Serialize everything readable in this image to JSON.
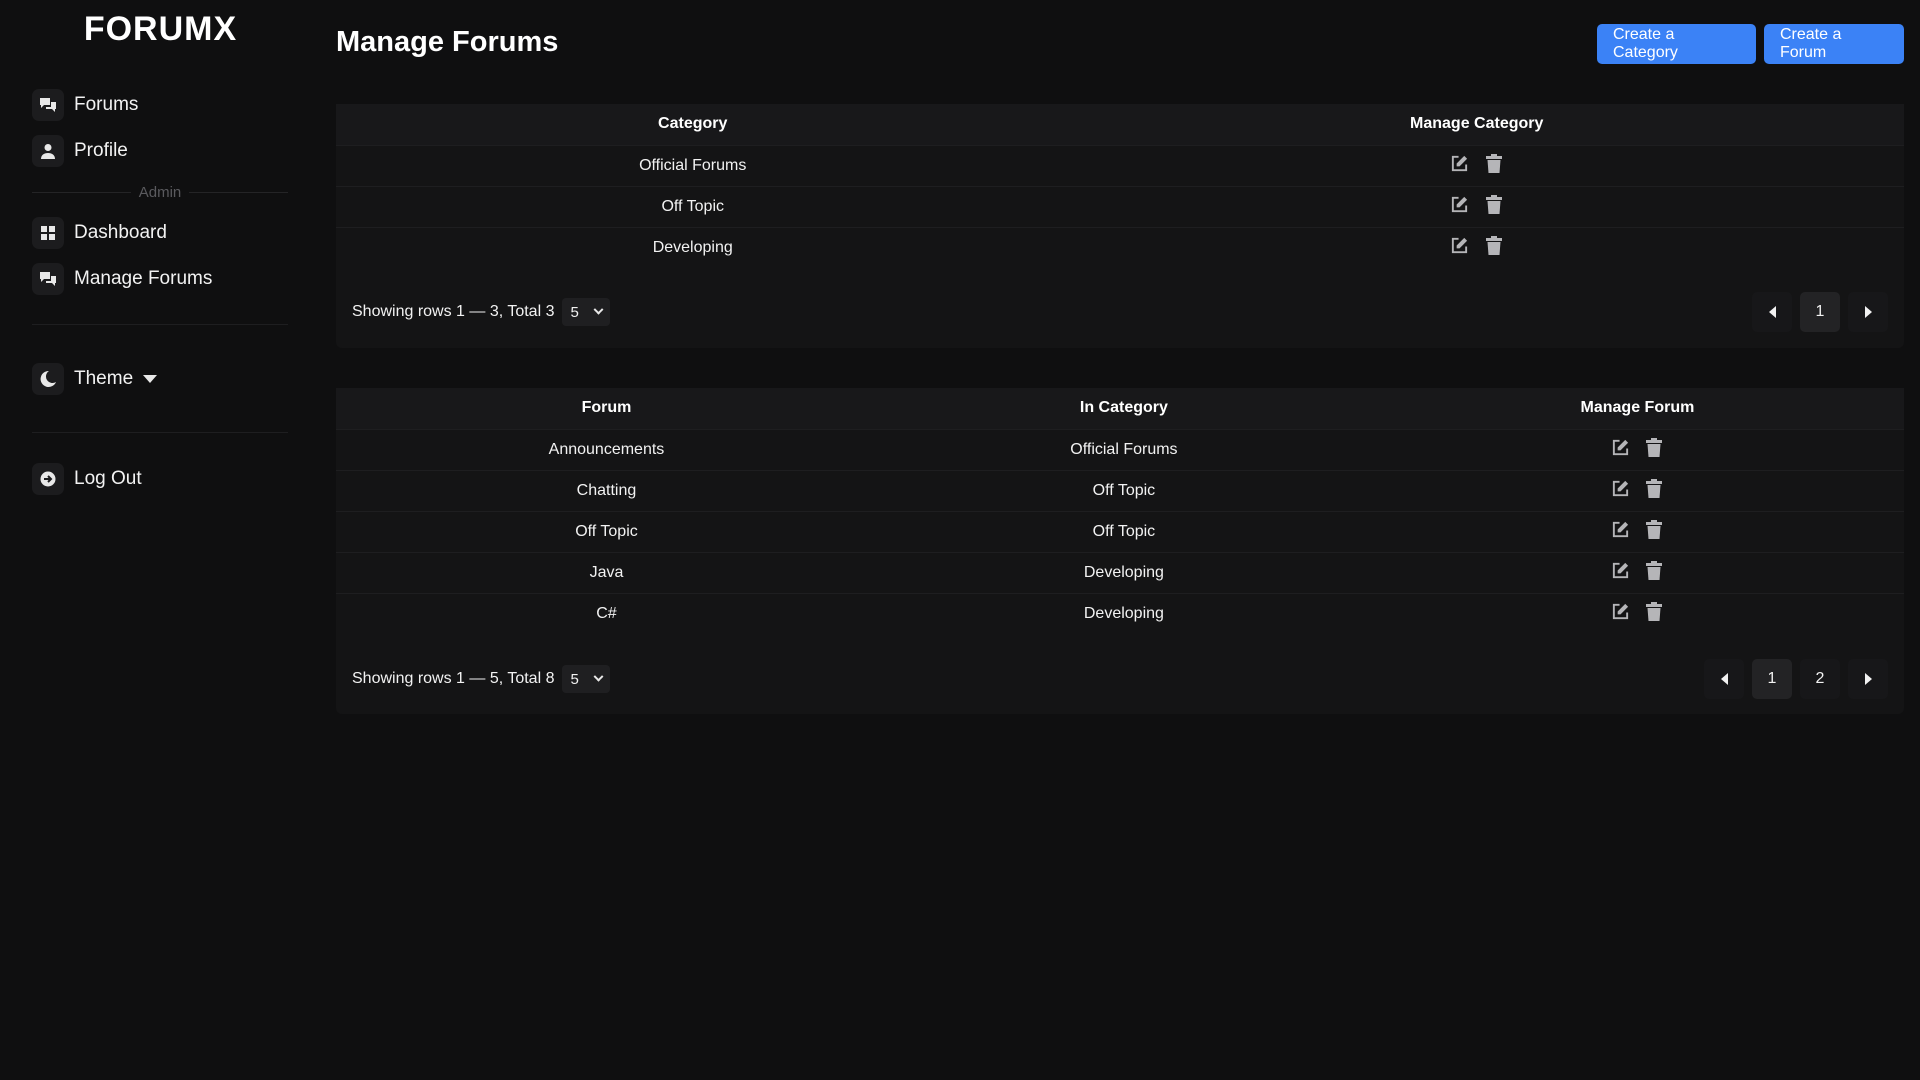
{
  "app": {
    "logo": "FORUMX"
  },
  "sidebar": {
    "items": [
      {
        "label": "Forums",
        "icon": "chat-bubbles-icon"
      },
      {
        "label": "Profile",
        "icon": "user-icon"
      }
    ],
    "admin_label": "Admin",
    "admin_items": [
      {
        "label": "Dashboard",
        "icon": "grid-icon"
      },
      {
        "label": "Manage Forums",
        "icon": "chat-bubbles-icon"
      }
    ],
    "theme_label": "Theme",
    "logout_label": "Log Out"
  },
  "header": {
    "title": "Manage Forums",
    "create_category_label": "Create a Category",
    "create_forum_label": "Create a Forum"
  },
  "categories_table": {
    "headers": [
      "Category",
      "Manage Category"
    ],
    "rows": [
      "Official Forums",
      "Off Topic",
      "Developing"
    ],
    "footer": "Showing rows 1 — 3, Total 3",
    "page_size": "5",
    "pages": [
      "1"
    ],
    "current_page": "1"
  },
  "forums_table": {
    "headers": [
      "Forum",
      "In Category",
      "Manage Forum"
    ],
    "rows": [
      {
        "forum": "Announcements",
        "category": "Official Forums"
      },
      {
        "forum": "Chatting",
        "category": "Off Topic"
      },
      {
        "forum": "Off Topic",
        "category": "Off Topic"
      },
      {
        "forum": "Java",
        "category": "Developing"
      },
      {
        "forum": "C#",
        "category": "Developing"
      }
    ],
    "footer": "Showing rows 1 — 5, Total 8",
    "page_size": "5",
    "pages": [
      "1",
      "2"
    ],
    "current_page": "1"
  },
  "colors": {
    "background": "#0f0f10",
    "panel": "#141415",
    "accent": "#3b82f6",
    "icon_gray": "#b5b5b8"
  }
}
